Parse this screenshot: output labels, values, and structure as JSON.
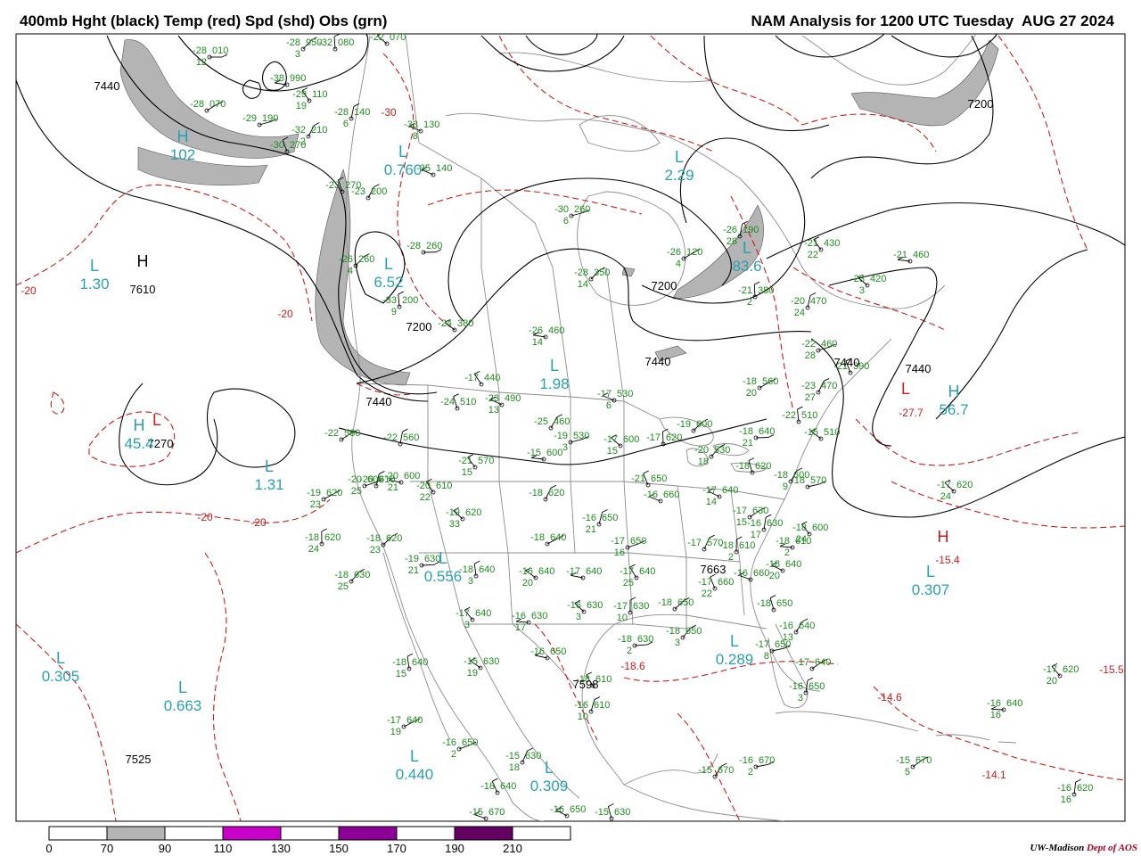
{
  "header": {
    "left_title": "400mb Hght (black) Temp (red) Spd (shd) Obs (grn)",
    "right_title": "NAM Analysis for 1200 UTC Tuesday  AUG 27 2024"
  },
  "colors": {
    "height_contour": "#000000",
    "temp_contour": "#c81e1e",
    "speed_70_90": "#b4b4b4",
    "speed_110_130": "#c800c8",
    "speed_150_170": "#8c0096",
    "speed_190_210": "#640064",
    "obs": "#1e8c1e",
    "center_label": "#28a0b4",
    "geography": "#8c8c8c"
  },
  "colorbar": {
    "ticks": [
      "0",
      "70",
      "90",
      "110",
      "130",
      "150",
      "170",
      "190",
      "210"
    ],
    "fills": [
      "#ffffff",
      "#b4b4b4",
      "#ffffff",
      "#c800c8",
      "#ffffff",
      "#8c0096",
      "#ffffff",
      "#640064",
      "#ffffff"
    ]
  },
  "credit": {
    "name": "UW-Madison",
    "dept": "Dept of AOS"
  },
  "height_labels": [
    "7440",
    "7610",
    "7200",
    "7200",
    "7440",
    "7440",
    "7440",
    "7440",
    "7200",
    "7663",
    "7598",
    "7525",
    "7270"
  ],
  "temp_labels": [
    "-20",
    "-20",
    "-20",
    "-20",
    "-30",
    "-27.7",
    "-15.4",
    "-18.6",
    "-14.6",
    "-15.5",
    "-14.1"
  ],
  "centers": [
    {
      "letter": "H",
      "value": "102",
      "kind": "cyan"
    },
    {
      "letter": "L",
      "value": "0.760",
      "kind": "cyan"
    },
    {
      "letter": "L",
      "value": "2.29",
      "kind": "cyan"
    },
    {
      "letter": "L",
      "value": "1.30",
      "kind": "cyan"
    },
    {
      "letter": "L",
      "value": "6.52",
      "kind": "cyan"
    },
    {
      "letter": "L",
      "value": "1.98",
      "kind": "cyan"
    },
    {
      "letter": "L",
      "value": "83.6",
      "kind": "cyan"
    },
    {
      "letter": "H",
      "value": "56.7",
      "kind": "cyan"
    },
    {
      "letter": "H",
      "value": "45.4",
      "kind": "cyan"
    },
    {
      "letter": "L",
      "value": "1.31",
      "kind": "cyan"
    },
    {
      "letter": "L",
      "value": "0.556",
      "kind": "cyan"
    },
    {
      "letter": "L",
      "value": "0.307",
      "kind": "cyan"
    },
    {
      "letter": "L",
      "value": "0.289",
      "kind": "cyan"
    },
    {
      "letter": "L",
      "value": "0.305",
      "kind": "cyan"
    },
    {
      "letter": "L",
      "value": "0.663",
      "kind": "cyan"
    },
    {
      "letter": "L",
      "value": "0.440",
      "kind": "cyan"
    },
    {
      "letter": "L",
      "value": "0.309",
      "kind": "cyan"
    },
    {
      "letter": "H",
      "value": "",
      "kind": "black"
    },
    {
      "letter": "L",
      "value": "",
      "kind": "red"
    },
    {
      "letter": "H",
      "value": "",
      "kind": "red"
    },
    {
      "letter": "L",
      "value": "",
      "kind": "red"
    }
  ],
  "stations": [
    {
      "t": "-28",
      "d": "12",
      "h": "010"
    },
    {
      "t": "-28",
      "d": "3",
      "h": "950"
    },
    {
      "t": "-32",
      "d": "",
      "h": "080"
    },
    {
      "t": "-22",
      "d": "",
      "h": "070"
    },
    {
      "t": "-38",
      "d": "",
      "h": "990"
    },
    {
      "t": "-29",
      "d": "19",
      "h": "110"
    },
    {
      "t": "-28",
      "d": "6",
      "h": "140"
    },
    {
      "t": "-28",
      "d": "",
      "h": "070"
    },
    {
      "t": "-29",
      "d": "",
      "h": "190"
    },
    {
      "t": "-32",
      "d": "2",
      "h": "210"
    },
    {
      "t": "-30",
      "d": "",
      "h": "270"
    },
    {
      "t": "-33",
      "d": "8",
      "h": "130"
    },
    {
      "t": "-35",
      "d": "",
      "h": "140"
    },
    {
      "t": "-23",
      "d": "",
      "h": "270"
    },
    {
      "t": "-23",
      "d": "",
      "h": "200"
    },
    {
      "t": "-30",
      "d": "6",
      "h": "260"
    },
    {
      "t": "-26",
      "d": "4",
      "h": "120"
    },
    {
      "t": "-26",
      "d": "28",
      "h": "190"
    },
    {
      "t": "-21",
      "d": "22",
      "h": "430"
    },
    {
      "t": "-21",
      "d": "",
      "h": "460"
    },
    {
      "t": "-23",
      "d": "3",
      "h": "420"
    },
    {
      "t": "-21",
      "d": "2",
      "h": "380"
    },
    {
      "t": "-28",
      "d": "14",
      "h": "350"
    },
    {
      "t": "-28",
      "d": "",
      "h": "260"
    },
    {
      "t": "-26",
      "d": "4",
      "h": "260"
    },
    {
      "t": "-33",
      "d": "9",
      "h": "200"
    },
    {
      "t": "-24",
      "d": "",
      "h": "380"
    },
    {
      "t": "-26",
      "d": "14",
      "h": "460"
    },
    {
      "t": "-17",
      "d": "",
      "h": "440"
    },
    {
      "t": "-20",
      "d": "24",
      "h": "470"
    },
    {
      "t": "-18",
      "d": "20",
      "h": "560"
    },
    {
      "t": "-22",
      "d": "28",
      "h": "460"
    },
    {
      "t": "-23",
      "d": "27",
      "h": "470"
    },
    {
      "t": "-21",
      "d": "",
      "h": "390"
    },
    {
      "t": "-17",
      "d": "6",
      "h": "530"
    },
    {
      "t": "-23",
      "d": "13",
      "h": "490"
    },
    {
      "t": "-24",
      "d": "",
      "h": "510"
    },
    {
      "t": "-25",
      "d": "",
      "h": "460"
    },
    {
      "t": "-19",
      "d": "3",
      "h": "530"
    },
    {
      "t": "-22",
      "d": "",
      "h": "560"
    },
    {
      "t": "-22",
      "d": "",
      "h": "560"
    },
    {
      "t": "-21",
      "d": "15",
      "h": "570"
    },
    {
      "t": "-15",
      "d": "",
      "h": "600"
    },
    {
      "t": "-17",
      "d": "15",
      "h": "600"
    },
    {
      "t": "-17",
      "d": "",
      "h": "620"
    },
    {
      "t": "-19",
      "d": "",
      "h": "600"
    },
    {
      "t": "-18",
      "d": "21",
      "h": "640"
    },
    {
      "t": "-20",
      "d": "18",
      "h": "530"
    },
    {
      "t": "-22",
      "d": "",
      "h": "510"
    },
    {
      "t": "-15",
      "d": "",
      "h": "510"
    },
    {
      "t": "-20",
      "d": "21",
      "h": "600"
    },
    {
      "t": "-20",
      "d": "22",
      "h": "610"
    },
    {
      "t": "-20",
      "d": "",
      "h": "610"
    },
    {
      "t": "-19",
      "d": "23",
      "h": "620"
    },
    {
      "t": "-20",
      "d": "25",
      "h": "600"
    },
    {
      "t": "-18",
      "d": "",
      "h": "620"
    },
    {
      "t": "-21",
      "d": "",
      "h": "650"
    },
    {
      "t": "-16",
      "d": "",
      "h": "660"
    },
    {
      "t": "-17",
      "d": "14",
      "h": "640"
    },
    {
      "t": "-18",
      "d": "",
      "h": "620"
    },
    {
      "t": "-18",
      "d": "9",
      "h": "600"
    },
    {
      "t": "-18",
      "d": "",
      "h": "570"
    },
    {
      "t": "-17",
      "d": "15",
      "h": "630"
    },
    {
      "t": "-16",
      "d": "17",
      "h": "630"
    },
    {
      "t": "-18",
      "d": "24",
      "h": "600"
    },
    {
      "t": "-18",
      "d": "2",
      "h": "610"
    },
    {
      "t": "-19",
      "d": "33",
      "h": "620"
    },
    {
      "t": "-18",
      "d": "24",
      "h": "620"
    },
    {
      "t": "-18",
      "d": "23",
      "h": "620"
    },
    {
      "t": "-19",
      "d": "21",
      "h": "630"
    },
    {
      "t": "-18",
      "d": "25",
      "h": "630"
    },
    {
      "t": "-18",
      "d": "3",
      "h": "640"
    },
    {
      "t": "-16",
      "d": "20",
      "h": "640"
    },
    {
      "t": "-17",
      "d": "",
      "h": "640"
    },
    {
      "t": "-17",
      "d": "25",
      "h": "640"
    },
    {
      "t": "-16",
      "d": "21",
      "h": "650"
    },
    {
      "t": "-18",
      "d": "",
      "h": "640"
    },
    {
      "t": "-17",
      "d": "16",
      "h": "650"
    },
    {
      "t": "-17",
      "d": "",
      "h": "570"
    },
    {
      "t": "-17",
      "d": "22",
      "h": "660"
    },
    {
      "t": "-16",
      "d": "",
      "h": "660"
    },
    {
      "t": "-18",
      "d": "20",
      "h": "640"
    },
    {
      "t": "-18",
      "d": "",
      "h": "650"
    },
    {
      "t": "-16",
      "d": "13",
      "h": "640"
    },
    {
      "t": "-17",
      "d": "8",
      "h": "650"
    },
    {
      "t": "-17",
      "d": "",
      "h": "640"
    },
    {
      "t": "-16",
      "d": "3",
      "h": "650"
    },
    {
      "t": "-17",
      "d": "3",
      "h": "640"
    },
    {
      "t": "-16",
      "d": "17",
      "h": "630"
    },
    {
      "t": "-16",
      "d": "3",
      "h": "630"
    },
    {
      "t": "-17",
      "d": "10",
      "h": "630"
    },
    {
      "t": "-18",
      "d": "",
      "h": "650"
    },
    {
      "t": "-18",
      "d": "2",
      "h": "630"
    },
    {
      "t": "-18",
      "d": "3",
      "h": "650"
    },
    {
      "t": "-18",
      "d": "15",
      "h": "640"
    },
    {
      "t": "-15",
      "d": "19",
      "h": "630"
    },
    {
      "t": "-16",
      "d": "",
      "h": "650"
    },
    {
      "t": "-18",
      "d": "",
      "h": "610"
    },
    {
      "t": "-16",
      "d": "10",
      "h": "610"
    },
    {
      "t": "-17",
      "d": "19",
      "h": "640"
    },
    {
      "t": "-16",
      "d": "2",
      "h": "650"
    },
    {
      "t": "-15",
      "d": "18",
      "h": "630"
    },
    {
      "t": "-18",
      "d": "",
      "h": "640"
    },
    {
      "t": "-15",
      "d": "",
      "h": "670"
    },
    {
      "t": "-16",
      "d": "",
      "h": "650"
    },
    {
      "t": "-15",
      "d": "",
      "h": "630"
    },
    {
      "t": "-15",
      "d": "",
      "h": "670"
    },
    {
      "t": "-16",
      "d": "2",
      "h": "670"
    },
    {
      "t": "-15",
      "d": "5",
      "h": "670"
    },
    {
      "t": "-16",
      "d": "16",
      "h": "620"
    },
    {
      "t": "-17",
      "d": "20",
      "h": "620"
    },
    {
      "t": "-16",
      "d": "16",
      "h": "640"
    },
    {
      "t": "-17",
      "d": "24",
      "h": "620"
    },
    {
      "t": "-18",
      "d": "2",
      "h": "610"
    }
  ]
}
